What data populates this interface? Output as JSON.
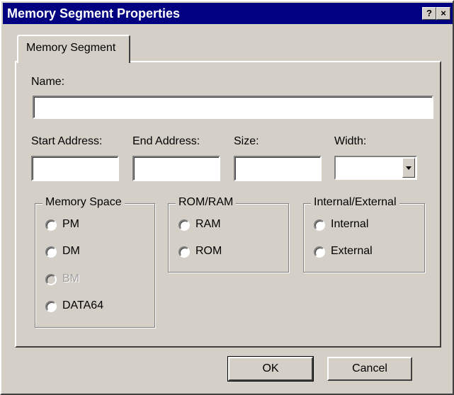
{
  "window": {
    "title": "Memory Segment Properties",
    "help_label": "?",
    "close_label": "×"
  },
  "tab": {
    "label": "Memory Segment"
  },
  "fields": {
    "name_label": "Name:",
    "name_value": "",
    "start_label": "Start Address:",
    "start_value": "",
    "end_label": "End Address:",
    "end_value": "",
    "size_label": "Size:",
    "size_value": "",
    "width_label": "Width:",
    "width_value": ""
  },
  "memory_space": {
    "legend": "Memory Space",
    "options": [
      {
        "label": "PM",
        "enabled": true
      },
      {
        "label": "DM",
        "enabled": true
      },
      {
        "label": "BM",
        "enabled": false
      },
      {
        "label": "DATA64",
        "enabled": true
      }
    ]
  },
  "rom_ram": {
    "legend": "ROM/RAM",
    "options": [
      {
        "label": "RAM",
        "enabled": true
      },
      {
        "label": "ROM",
        "enabled": true
      }
    ]
  },
  "internal_external": {
    "legend": "Internal/External",
    "options": [
      {
        "label": "Internal",
        "enabled": true
      },
      {
        "label": "External",
        "enabled": true
      }
    ]
  },
  "buttons": {
    "ok": "OK",
    "cancel": "Cancel"
  },
  "colors": {
    "titlebar": "#000080",
    "face": "#d4d0c8",
    "disabled_text": "#a0a0a0"
  }
}
